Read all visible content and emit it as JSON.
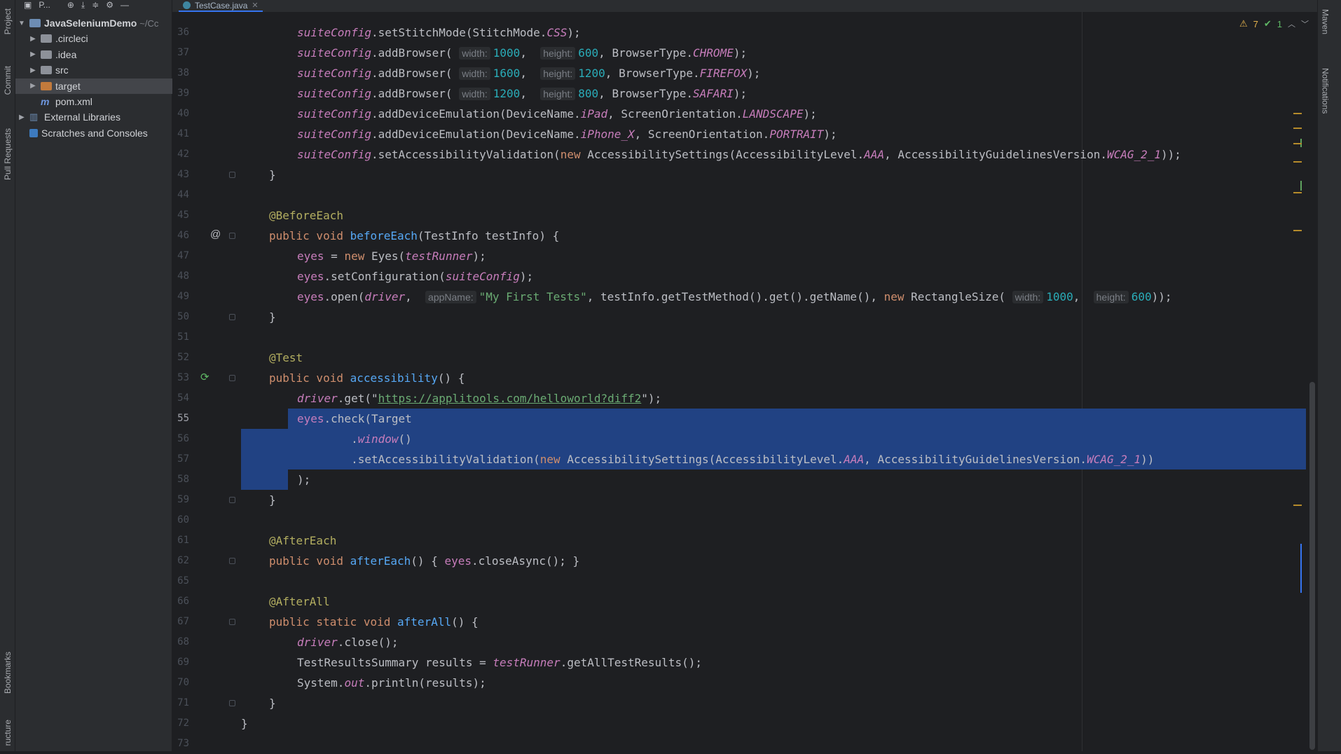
{
  "left_strip": {
    "project": "Project",
    "commit": "Commit",
    "pull_requests": "Pull Requests",
    "bookmarks": "Bookmarks",
    "structure": "ructure"
  },
  "right_strip": {
    "maven": "Maven",
    "notifications": "Notifications"
  },
  "project_panel": {
    "title": "P...",
    "tree": [
      {
        "label": "JavaSeleniumDemo",
        "path": "~/Cc",
        "level": 0,
        "expanded": true,
        "icon": "module",
        "bold": true
      },
      {
        "label": ".circleci",
        "level": 1,
        "icon": "folder"
      },
      {
        "label": ".idea",
        "level": 1,
        "icon": "folder"
      },
      {
        "label": "src",
        "level": 1,
        "icon": "folder"
      },
      {
        "label": "target",
        "level": 1,
        "icon": "folder-orange",
        "selected": true
      },
      {
        "label": "pom.xml",
        "level": 1,
        "icon": "maven"
      },
      {
        "label": "External Libraries",
        "level": 0,
        "icon": "libraries"
      },
      {
        "label": "Scratches and Consoles",
        "level": 0,
        "icon": "scratch"
      }
    ]
  },
  "editor": {
    "tab": "TestCase.java",
    "current_line": "55",
    "inspections": {
      "warnings": "7",
      "ok": "1"
    },
    "lines": [
      {
        "n": "36",
        "segs": [
          [
            "fld",
            "suiteConfig"
          ],
          [
            "",
            "."
          ],
          [
            "",
            "setStitchMode(StitchMode."
          ],
          [
            "const",
            "CSS"
          ],
          [
            "",
            ");"
          ]
        ]
      },
      {
        "n": "37",
        "segs": [
          [
            "fld",
            "suiteConfig"
          ],
          [
            "",
            ".addBrowser( "
          ],
          [
            "hint",
            "width:"
          ],
          [
            "num",
            "1000"
          ],
          [
            "",
            ",  "
          ],
          [
            "hint",
            "height:"
          ],
          [
            "num",
            "600"
          ],
          [
            "",
            ", BrowserType."
          ],
          [
            "const",
            "CHROME"
          ],
          [
            "",
            ");"
          ]
        ]
      },
      {
        "n": "38",
        "segs": [
          [
            "fld",
            "suiteConfig"
          ],
          [
            "",
            ".addBrowser( "
          ],
          [
            "hint",
            "width:"
          ],
          [
            "num",
            "1600"
          ],
          [
            "",
            ",  "
          ],
          [
            "hint",
            "height:"
          ],
          [
            "num",
            "1200"
          ],
          [
            "",
            ", BrowserType."
          ],
          [
            "const",
            "FIREFOX"
          ],
          [
            "",
            ");"
          ]
        ]
      },
      {
        "n": "39",
        "segs": [
          [
            "fld",
            "suiteConfig"
          ],
          [
            "",
            ".addBrowser( "
          ],
          [
            "hint",
            "width:"
          ],
          [
            "num",
            "1200"
          ],
          [
            "",
            ",  "
          ],
          [
            "hint",
            "height:"
          ],
          [
            "num",
            "800"
          ],
          [
            "",
            ", BrowserType."
          ],
          [
            "const",
            "SAFARI"
          ],
          [
            "",
            ");"
          ]
        ]
      },
      {
        "n": "40",
        "segs": [
          [
            "fld",
            "suiteConfig"
          ],
          [
            "",
            ".addDeviceEmulation(DeviceName."
          ],
          [
            "const",
            "iPad"
          ],
          [
            "",
            ", ScreenOrientation."
          ],
          [
            "const",
            "LANDSCAPE"
          ],
          [
            "",
            ");"
          ]
        ]
      },
      {
        "n": "41",
        "segs": [
          [
            "fld",
            "suiteConfig"
          ],
          [
            "",
            ".addDeviceEmulation(DeviceName."
          ],
          [
            "const",
            "iPhone_X"
          ],
          [
            "",
            ", ScreenOrientation."
          ],
          [
            "const",
            "PORTRAIT"
          ],
          [
            "",
            ");"
          ]
        ]
      },
      {
        "n": "42",
        "segs": [
          [
            "fld",
            "suiteConfig"
          ],
          [
            "",
            ".setAccessibilityValidation("
          ],
          [
            "kw",
            "new"
          ],
          [
            "",
            "",
            " AccessibilitySettings(AccessibilityLevel."
          ],
          [
            "const",
            "AAA"
          ],
          [
            "",
            ", AccessibilityGuidelinesVersion."
          ],
          [
            "const",
            "WCAG_2_1"
          ],
          [
            "",
            "));"
          ]
        ]
      },
      {
        "n": "43",
        "segs": [
          [
            "",
            "}"
          ]
        ]
      },
      {
        "n": "44",
        "segs": []
      },
      {
        "n": "45",
        "segs": [
          [
            "ann",
            "@BeforeEach"
          ]
        ]
      },
      {
        "n": "46",
        "segs": [
          [
            "kw",
            "public void "
          ],
          [
            "fn",
            "beforeEach"
          ],
          [
            "",
            "(TestInfo testInfo) {"
          ]
        ]
      },
      {
        "n": "47",
        "segs": [
          [
            "fldn",
            "eyes"
          ],
          [
            "",
            " = "
          ],
          [
            "kw",
            "new"
          ],
          [
            "",
            " Eyes("
          ],
          [
            "fld",
            "testRunner"
          ],
          [
            "",
            ");"
          ]
        ]
      },
      {
        "n": "48",
        "segs": [
          [
            "fldn",
            "eyes"
          ],
          [
            "",
            ".setConfiguration("
          ],
          [
            "fld",
            "suiteConfig"
          ],
          [
            "",
            ");"
          ]
        ]
      },
      {
        "n": "49",
        "segs": [
          [
            "fldn",
            "eyes"
          ],
          [
            "",
            ".open("
          ],
          [
            "fld",
            "driver"
          ],
          [
            "",
            ",  "
          ],
          [
            "hint",
            "appName:"
          ],
          [
            "str",
            "\"My First Tests\""
          ],
          [
            "",
            ", testInfo.getTestMethod().get().getName(), "
          ],
          [
            "kw",
            "new"
          ],
          [
            "",
            " RectangleSize( "
          ],
          [
            "hint",
            "width:"
          ],
          [
            "num",
            "1000"
          ],
          [
            "",
            ",  "
          ],
          [
            "hint",
            "height:"
          ],
          [
            "num",
            "600"
          ],
          [
            "",
            "));"
          ]
        ]
      },
      {
        "n": "50",
        "segs": [
          [
            "",
            "}"
          ]
        ]
      },
      {
        "n": "51",
        "segs": []
      },
      {
        "n": "52",
        "segs": [
          [
            "ann",
            "@Test"
          ]
        ]
      },
      {
        "n": "53",
        "segs": [
          [
            "kw",
            "public void "
          ],
          [
            "fn",
            "accessibility"
          ],
          [
            "",
            "() {"
          ]
        ]
      },
      {
        "n": "54",
        "segs": [
          [
            "fld",
            "driver"
          ],
          [
            "",
            ".get(\""
          ],
          [
            "url",
            "https://applitools.com/helloworld?diff2"
          ],
          [
            "",
            "\");"
          ]
        ]
      },
      {
        "n": "55",
        "segs": [
          [
            "fldn",
            "eyes"
          ],
          [
            "",
            ".check(Target"
          ]
        ]
      },
      {
        "n": "56",
        "segs": [
          [
            "",
            "        ."
          ],
          [
            "fld",
            "window"
          ],
          [
            "",
            "()"
          ]
        ]
      },
      {
        "n": "57",
        "segs": [
          [
            "",
            "        .setAccessibilityValidation("
          ],
          [
            "kw",
            "new"
          ],
          [
            "",
            " AccessibilitySettings(AccessibilityLevel."
          ],
          [
            "const",
            "AAA"
          ],
          [
            "",
            ", AccessibilityGuidelinesVersion."
          ],
          [
            "const",
            "WCAG_2_1"
          ],
          [
            "",
            "))"
          ]
        ]
      },
      {
        "n": "58",
        "segs": [
          [
            "",
            ");"
          ]
        ]
      },
      {
        "n": "59",
        "segs": [
          [
            "",
            "}"
          ]
        ]
      },
      {
        "n": "60",
        "segs": []
      },
      {
        "n": "61",
        "segs": [
          [
            "ann",
            "@AfterEach"
          ]
        ]
      },
      {
        "n": "62",
        "segs": [
          [
            "kw",
            "public void "
          ],
          [
            "fn",
            "afterEach"
          ],
          [
            "",
            "() { "
          ],
          [
            "fldn",
            "eyes"
          ],
          [
            "",
            ".closeAsync(); }"
          ]
        ]
      },
      {
        "n": "65",
        "segs": []
      },
      {
        "n": "66",
        "segs": [
          [
            "ann",
            "@AfterAll"
          ]
        ]
      },
      {
        "n": "67",
        "segs": [
          [
            "kw",
            "public static void "
          ],
          [
            "fn",
            "afterAll"
          ],
          [
            "",
            "() {"
          ]
        ]
      },
      {
        "n": "68",
        "segs": [
          [
            "fld",
            "driver"
          ],
          [
            "",
            ".close();"
          ]
        ]
      },
      {
        "n": "69",
        "segs": [
          [
            "",
            "TestResultsSummary results = "
          ],
          [
            "fld",
            "testRunner"
          ],
          [
            "",
            ".getAllTestResults();"
          ]
        ]
      },
      {
        "n": "70",
        "segs": [
          [
            "",
            "System."
          ],
          [
            "fld",
            "out"
          ],
          [
            "",
            ".println(results);"
          ]
        ]
      },
      {
        "n": "71",
        "segs": [
          [
            "",
            "}"
          ]
        ]
      },
      {
        "n": "72",
        "segs": [
          [
            "",
            "}"
          ]
        ]
      },
      {
        "n": "73",
        "segs": []
      }
    ]
  }
}
